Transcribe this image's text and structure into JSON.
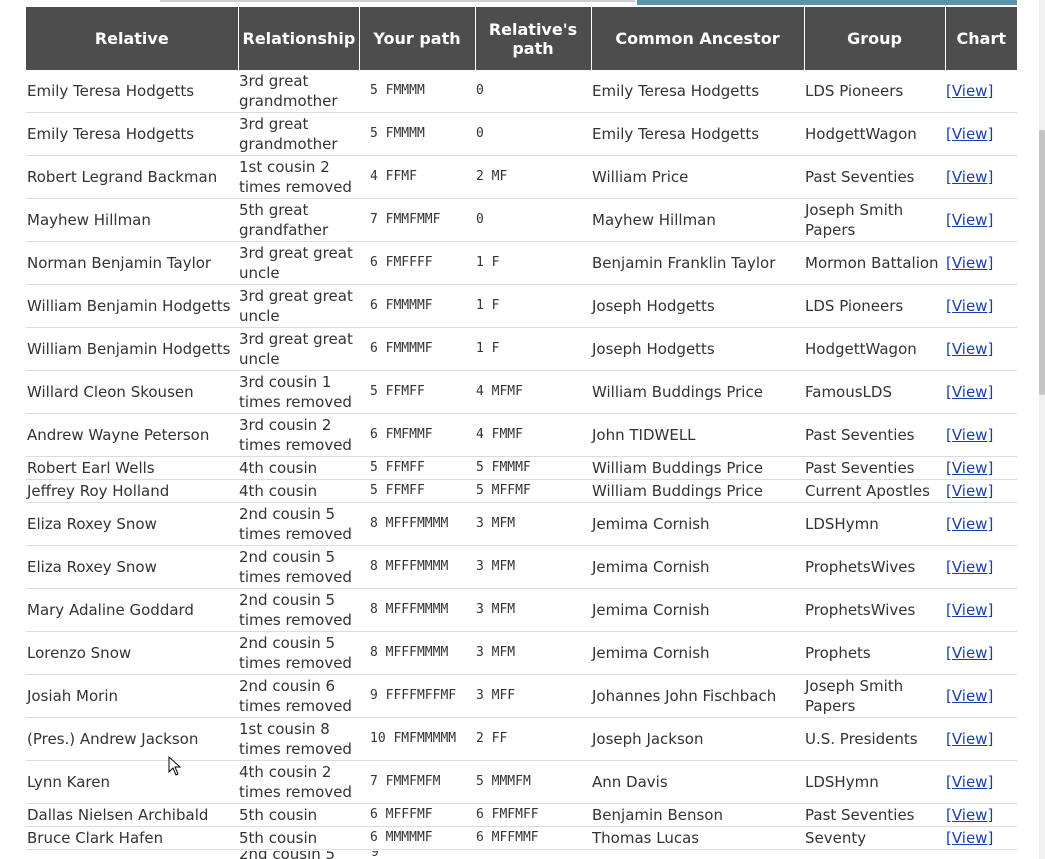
{
  "table": {
    "headers": [
      "Relative",
      "Relationship",
      "Your path",
      "Relative's path",
      "Common Ancestor",
      "Group",
      "Chart"
    ],
    "link_label": "[View]",
    "rows": [
      {
        "relative": "Emily Teresa Hodgetts",
        "relationship": "3rd great grandmother",
        "your_path": "5  FMMMM",
        "relative_path": "0",
        "ancestor": "Emily Teresa Hodgetts",
        "group": "LDS Pioneers"
      },
      {
        "relative": "Emily Teresa Hodgetts",
        "relationship": "3rd great grandmother",
        "your_path": "5  FMMMM",
        "relative_path": "0",
        "ancestor": "Emily Teresa Hodgetts",
        "group": "HodgettWagon"
      },
      {
        "relative": "Robert Legrand Backman",
        "relationship": "1st cousin 2 times removed",
        "your_path": "4  FFMF",
        "relative_path": "2  MF",
        "ancestor": "William Price",
        "group": "Past Seventies"
      },
      {
        "relative": "Mayhew Hillman",
        "relationship": "5th great grandfather",
        "your_path": "7  FMMFMMF",
        "relative_path": "0",
        "ancestor": "Mayhew Hillman",
        "group": "Joseph Smith Papers"
      },
      {
        "relative": "Norman Benjamin Taylor",
        "relationship": "3rd great great uncle",
        "your_path": "6  FMFFFF",
        "relative_path": "1  F",
        "ancestor": "Benjamin Franklin Taylor",
        "group": "Mormon Battalion"
      },
      {
        "relative": "William Benjamin Hodgetts",
        "relationship": "3rd great great uncle",
        "your_path": "6  FMMMMF",
        "relative_path": "1  F",
        "ancestor": "Joseph Hodgetts",
        "group": "LDS Pioneers"
      },
      {
        "relative": "William Benjamin Hodgetts",
        "relationship": "3rd great great uncle",
        "your_path": "6  FMMMMF",
        "relative_path": "1  F",
        "ancestor": "Joseph Hodgetts",
        "group": "HodgettWagon"
      },
      {
        "relative": "Willard Cleon Skousen",
        "relationship": "3rd cousin 1 times removed",
        "your_path": "5  FFMFF",
        "relative_path": "4  MFMF",
        "ancestor": "William Buddings Price",
        "group": "FamousLDS"
      },
      {
        "relative": "Andrew Wayne Peterson",
        "relationship": "3rd cousin 2 times removed",
        "your_path": "6  FMFMMF",
        "relative_path": "4  FMMF",
        "ancestor": "John TIDWELL",
        "group": "Past Seventies"
      },
      {
        "relative": "Robert Earl Wells",
        "relationship": "4th cousin",
        "your_path": "5  FFMFF",
        "relative_path": "5  FMMMF",
        "ancestor": "William Buddings Price",
        "group": "Past Seventies",
        "short": true
      },
      {
        "relative": "Jeffrey Roy Holland",
        "relationship": "4th cousin",
        "your_path": "5  FFMFF",
        "relative_path": "5  MFFMF",
        "ancestor": "William Buddings Price",
        "group": "Current Apostles",
        "short": true
      },
      {
        "relative": "Eliza Roxey Snow",
        "relationship": "2nd cousin 5 times removed",
        "your_path": "8  MFFFMMMM",
        "relative_path": "3  MFM",
        "ancestor": "Jemima Cornish",
        "group": "LDSHymn"
      },
      {
        "relative": "Eliza Roxey Snow",
        "relationship": "2nd cousin 5 times removed",
        "your_path": "8  MFFFMMMM",
        "relative_path": "3  MFM",
        "ancestor": "Jemima Cornish",
        "group": "ProphetsWives"
      },
      {
        "relative": "Mary Adaline Goddard",
        "relationship": "2nd cousin 5 times removed",
        "your_path": "8  MFFFMMMM",
        "relative_path": "3  MFM",
        "ancestor": "Jemima Cornish",
        "group": "ProphetsWives"
      },
      {
        "relative": "Lorenzo Snow",
        "relationship": "2nd cousin 5 times removed",
        "your_path": "8  MFFFMMMM",
        "relative_path": "3  MFM",
        "ancestor": "Jemima Cornish",
        "group": "Prophets"
      },
      {
        "relative": "Josiah Morin",
        "relationship": "2nd cousin 6 times removed",
        "your_path": "9 FFFFMFFMF",
        "relative_path": "3  MFF",
        "ancestor": "Johannes John Fischbach",
        "group": "Joseph Smith Papers"
      },
      {
        "relative": "(Pres.) Andrew Jackson",
        "relationship": "1st cousin 8 times removed",
        "your_path": "10 FMFMMMMM",
        "relative_path": "2  FF",
        "ancestor": "Joseph Jackson",
        "group": "U.S. Presidents"
      },
      {
        "relative": "Lynn Karen",
        "relationship": "4th cousin 2 times removed",
        "your_path": "7  FMMFMFM",
        "relative_path": "5  MMMFM",
        "ancestor": "Ann Davis",
        "group": "LDSHymn"
      },
      {
        "relative": "Dallas Nielsen Archibald",
        "relationship": "5th cousin",
        "your_path": "6  MFFFMF",
        "relative_path": "6  FMFMFF",
        "ancestor": "Benjamin Benson",
        "group": "Past Seventies",
        "short": true
      },
      {
        "relative": "Bruce Clark Hafen",
        "relationship": "5th cousin",
        "your_path": "6  MMMMMF",
        "relative_path": "6  MFFMMF",
        "ancestor": "Thomas Lucas",
        "group": "Seventy",
        "short": true
      }
    ]
  },
  "partial_row": {
    "relationship": "2nd cousin 5",
    "your_path": "9"
  }
}
